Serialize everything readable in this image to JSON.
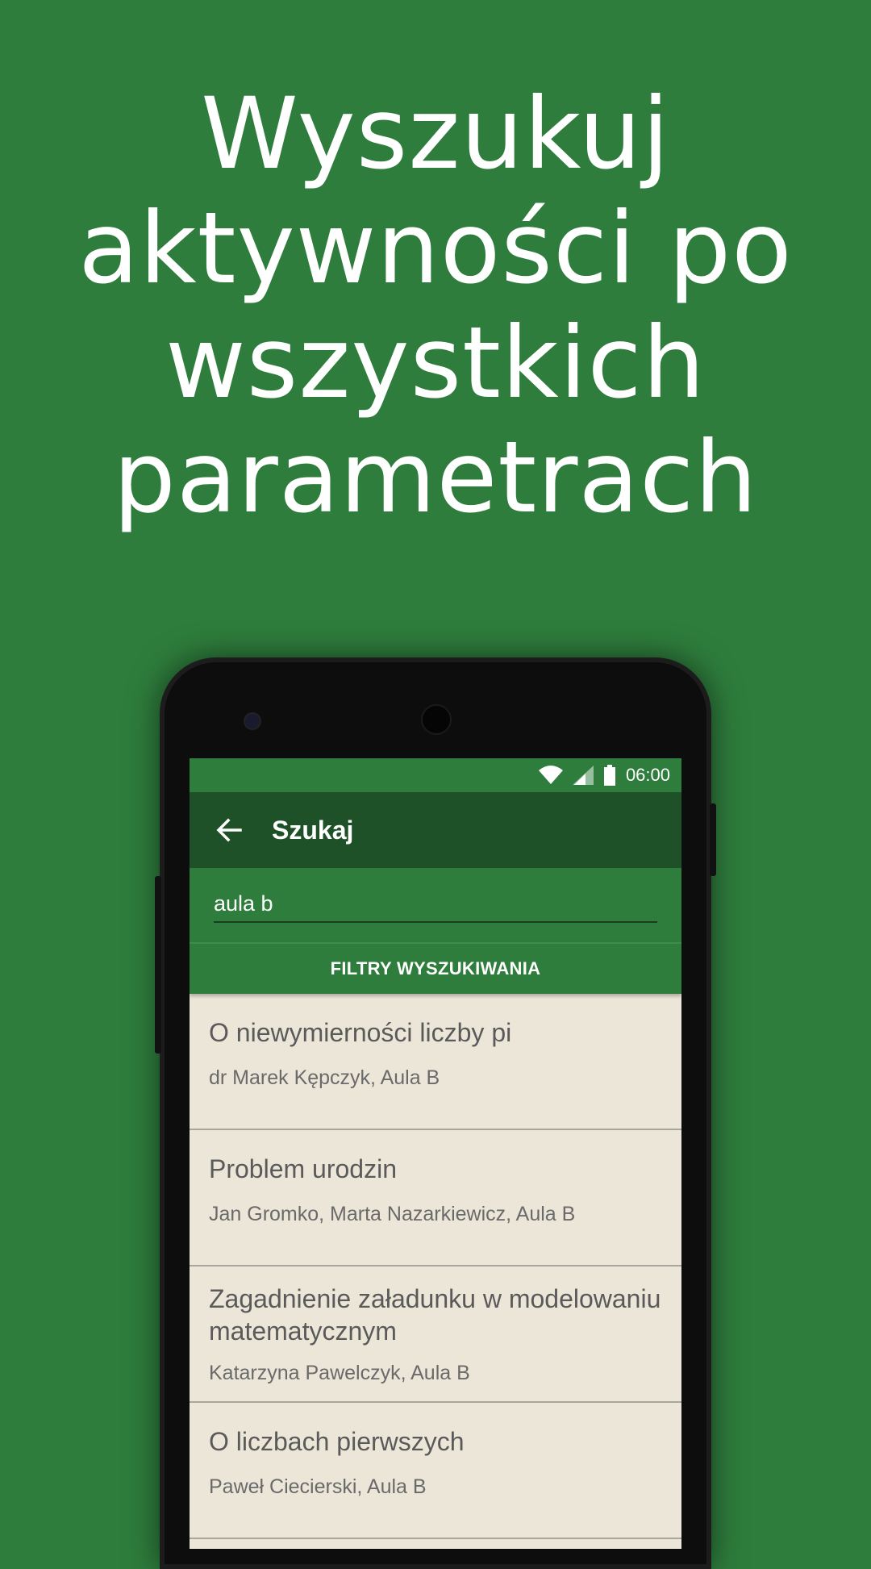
{
  "headline": {
    "lines": [
      "Wyszukuj",
      "aktywności po",
      "wszystkich",
      "parametrach"
    ]
  },
  "colors": {
    "background": "#2e7d3c",
    "appbar": "#1f5128",
    "list_background": "#ece6d9"
  },
  "status_bar": {
    "time": "06:00",
    "icons": [
      "wifi-icon",
      "signal-icon",
      "battery-icon"
    ]
  },
  "app_bar": {
    "back_icon": "arrow-left-icon",
    "title": "Szukaj"
  },
  "search": {
    "value": "aula b"
  },
  "filters_button": {
    "label": "FILTRY WYSZUKIWANIA"
  },
  "results": [
    {
      "title": "O niewymierności liczby pi",
      "subtitle": "dr Marek Kępczyk, Aula B"
    },
    {
      "title": "Problem urodzin",
      "subtitle": "Jan Gromko, Marta Nazarkiewicz, Aula B"
    },
    {
      "title": "Zagadnienie załadunku w modelowaniu matematycznym",
      "subtitle": "Katarzyna Pawelczyk, Aula B"
    },
    {
      "title": "O liczbach pierwszych",
      "subtitle": "Paweł Ciecierski, Aula B"
    }
  ]
}
